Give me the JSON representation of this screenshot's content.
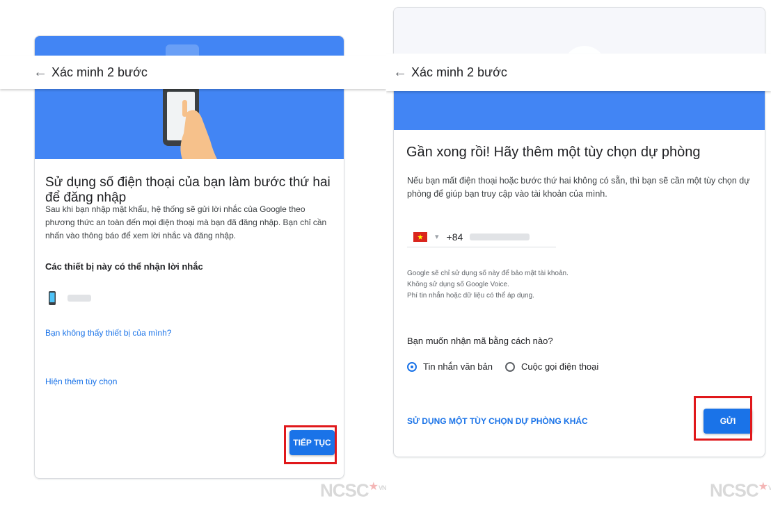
{
  "left": {
    "appbar": {
      "back_icon": "←",
      "title": "Xác minh 2 bước"
    },
    "heading": "Sử dụng số điện thoại của bạn làm bước thứ hai để đăng nhập",
    "description": "Sau khi bạn nhập mật khẩu, hệ thống sẽ gửi lời nhắc của Google theo phương thức an toàn đến mọi điện thoại mà bạn đã đăng nhập. Bạn chỉ cần nhấn vào thông báo để xem lời nhắc và đăng nhập.",
    "devices_heading": "Các thiết bị này có thể nhận lời nhắc",
    "device_icon": "phone-icon",
    "missing_device_link": "Bạn không thấy thiết bị của mình?",
    "more_options_link": "Hiện thêm tùy chọn",
    "continue_button": "TIẾP TỤC"
  },
  "right": {
    "appbar": {
      "back_icon": "←",
      "title": "Xác minh 2 bước"
    },
    "heading": "Gần xong rồi! Hãy thêm một tùy chọn dự phòng",
    "description": "Nếu bạn mất điện thoại hoặc bước thứ hai không có sẵn, thì bạn sẽ cần một tùy chọn dự phòng để giúp bạn truy cập vào tài khoản của mình.",
    "phone": {
      "flag_icon": "vietnam-flag-icon",
      "dropdown_icon": "▾",
      "country_code": "+84"
    },
    "notes": [
      "Google sẽ chỉ sử dụng số này để bảo mật tài khoản.",
      "Không sử dụng số Google Voice.",
      "Phí tin nhắn hoặc dữ liệu có thể áp dụng."
    ],
    "method_question": "Bạn muốn nhận mã bằng cách nào?",
    "method_options": [
      {
        "label": "Tin nhắn văn bản",
        "selected": true
      },
      {
        "label": "Cuộc gọi điện thoại",
        "selected": false
      }
    ],
    "other_backup_link": "SỬ DỤNG MỘT TÙY CHỌN DỰ PHÒNG KHÁC",
    "send_button": "GỬI"
  },
  "watermark": {
    "text": "NCSC",
    "sub": "VN"
  },
  "colors": {
    "accent": "#4285f4",
    "button": "#1a73e8",
    "highlight": "#e0181b",
    "flag_red": "#da251d",
    "flag_star": "#ffff00"
  }
}
